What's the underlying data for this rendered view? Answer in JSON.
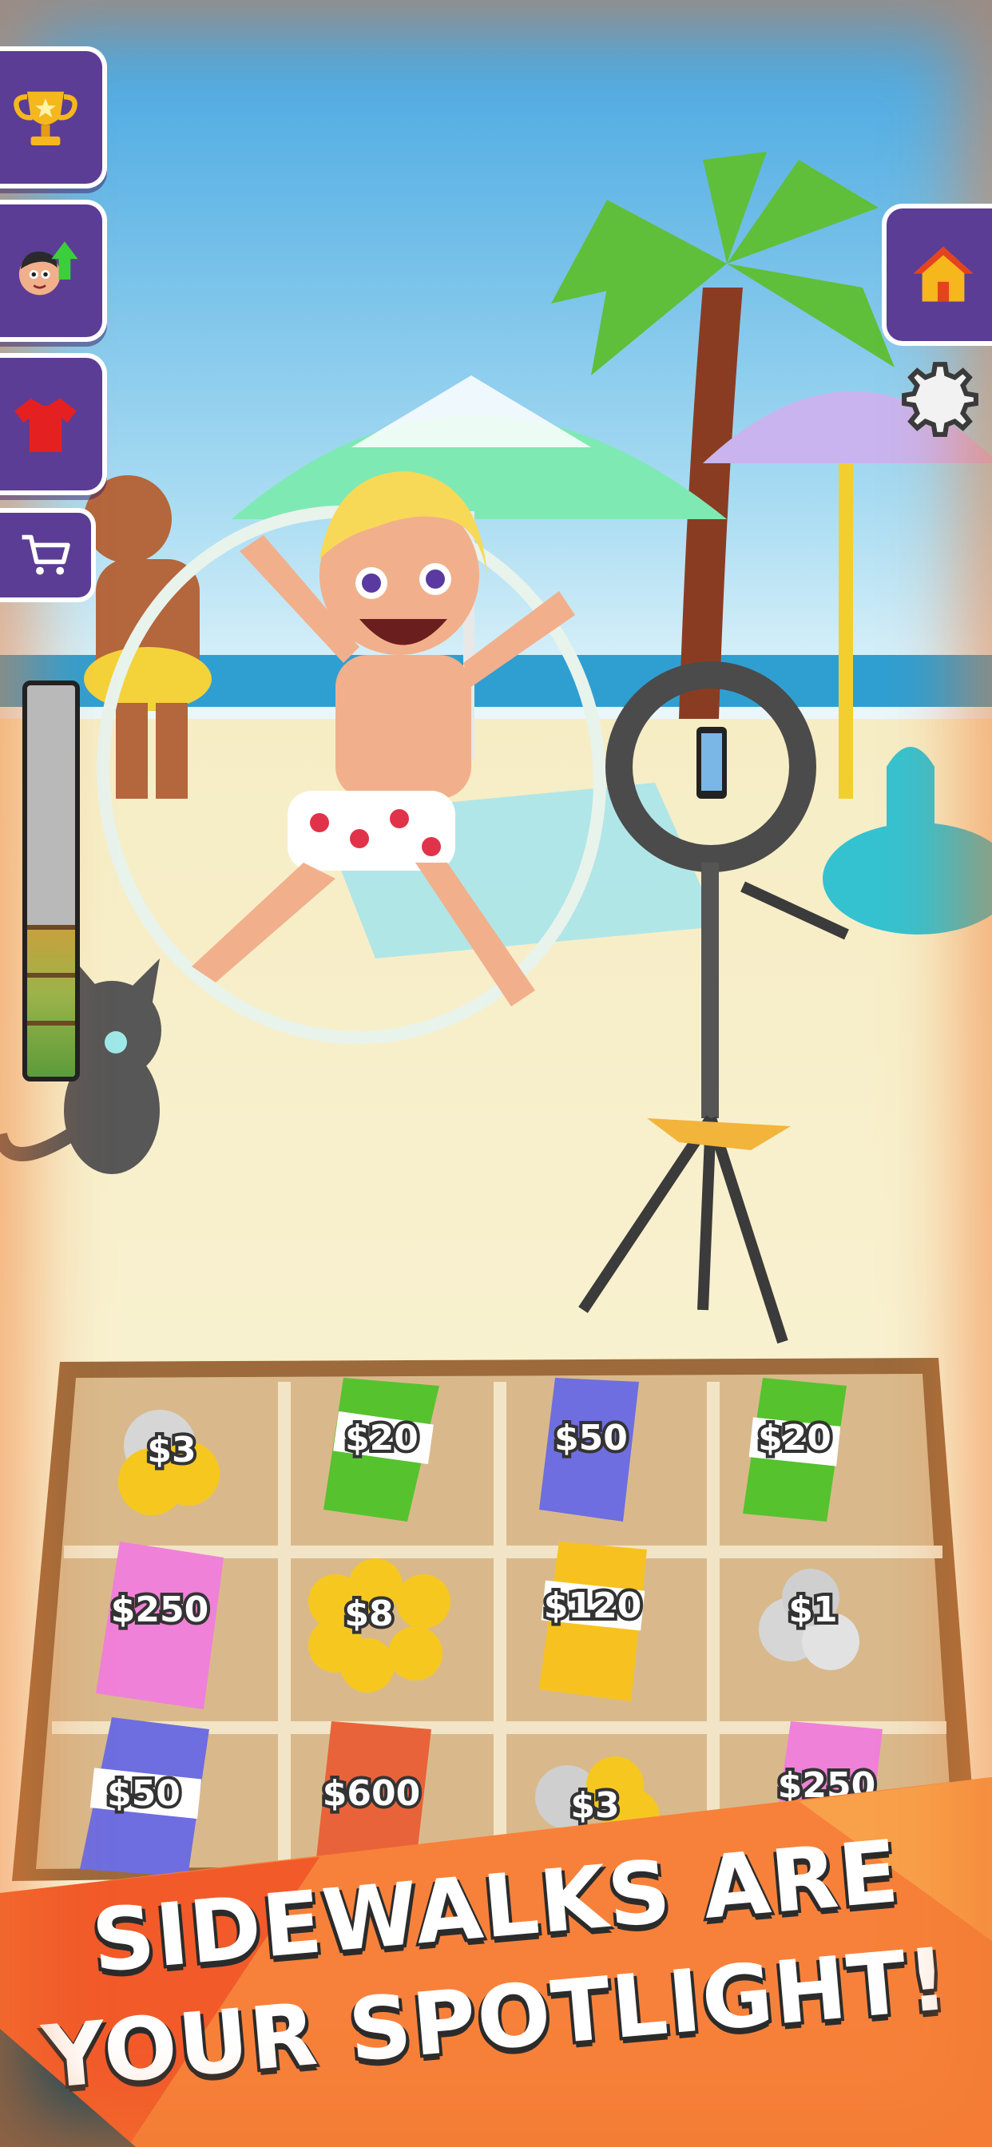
{
  "hud": {
    "left_menu": [
      {
        "name": "trophy-icon"
      },
      {
        "name": "character-upgrade-icon"
      },
      {
        "name": "shirt-icon"
      },
      {
        "name": "shop-cart-icon"
      }
    ],
    "right_menu": [
      {
        "name": "home-icon"
      },
      {
        "name": "settings-gear-icon"
      }
    ],
    "energy_meter": {
      "fill_fraction": 0.38
    }
  },
  "tray": {
    "rows": [
      [
        {
          "label": "$3",
          "kind": "coins-silver-gold"
        },
        {
          "label": "$20",
          "kind": "cash-green"
        },
        {
          "label": "$50",
          "kind": "cash-blue"
        },
        {
          "label": "$20",
          "kind": "cash-green"
        }
      ],
      [
        {
          "label": "$250",
          "kind": "cash-pink"
        },
        {
          "label": "$8",
          "kind": "coins-gold"
        },
        {
          "label": "$120",
          "kind": "cash-yellow"
        },
        {
          "label": "$1",
          "kind": "coins-silver"
        }
      ],
      [
        {
          "label": "$50",
          "kind": "cash-blue"
        },
        {
          "label": "$600",
          "kind": "cash-red"
        },
        {
          "label": "$3",
          "kind": "coins-silver-gold"
        },
        {
          "label": "$250",
          "kind": "cash-pink"
        }
      ]
    ]
  },
  "banner": {
    "line1": "SIDEWALKS ARE",
    "line2": "YOUR SPOTLIGHT!"
  },
  "colors": {
    "button_purple": "#5b3d95",
    "sky": "#5bb4e6",
    "sand": "#f4e9c6",
    "banner_orange": "#f7813a"
  }
}
